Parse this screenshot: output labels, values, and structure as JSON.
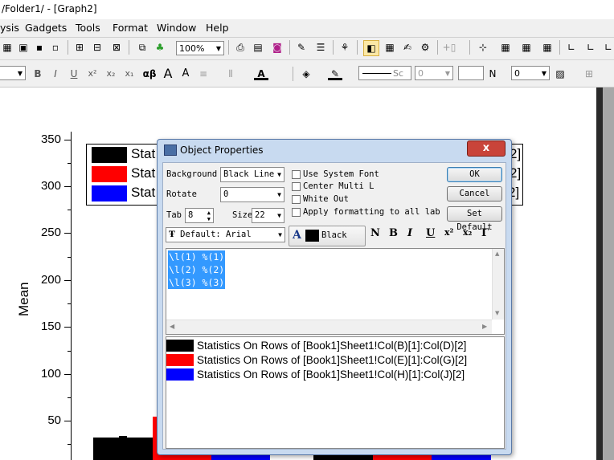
{
  "window": {
    "title": "/Folder1/ - [Graph2]"
  },
  "menu": [
    "ysis",
    "Gadgets",
    "Tools",
    "Format",
    "Window",
    "Help"
  ],
  "toolbar": {
    "zoom": "100%",
    "line_field": "Sc",
    "num_field": "0",
    "n_label": "N",
    "n_field": "0",
    "style_buttons": [
      "B",
      "I",
      "U",
      "x²",
      "x₂",
      "x₁",
      "αβ",
      "A",
      "A"
    ]
  },
  "graph": {
    "ylabel": "Mean",
    "yticks": [
      "350",
      "300",
      "250",
      "200",
      "150",
      "100",
      "50"
    ],
    "legend_visible": [
      "Stat",
      "Stat",
      "Stat"
    ],
    "legend_right": [
      "2]",
      "2]",
      "2]"
    ],
    "colors": {
      "black": "#000000",
      "red": "#ff0000",
      "blue": "#0000ff"
    }
  },
  "dialog": {
    "title": "Object Properties",
    "close": "x",
    "background_label": "Background",
    "background_value": "Black Line",
    "rotate_label": "Rotate",
    "rotate_value": "0",
    "tab_label": "Tab",
    "tab_value": "8",
    "size_label": "Size",
    "size_value": "22",
    "checkboxes": [
      "Use System Font",
      "Center Multi L",
      "White Out",
      "Apply formatting to all label"
    ],
    "ok": "OK",
    "cancel": "Cancel",
    "set_default": "Set Default",
    "font_value": "Default: Arial",
    "color_label": "Black",
    "format_buttons": [
      "N",
      "B",
      "I",
      "U",
      "x²",
      "x₂",
      "Γ"
    ],
    "text_lines": [
      "\\l(1) %(1)",
      "\\l(2) %(2)",
      "\\l(3) %(3)"
    ],
    "preview": [
      {
        "text": "Statistics On Rows of [Book1]Sheet1!Col(B)[1]:Col(D)[2]",
        "color": "#000000"
      },
      {
        "text": "Statistics On Rows of [Book1]Sheet1!Col(E)[1]:Col(G)[2]",
        "color": "#ff0000"
      },
      {
        "text": "Statistics On Rows of [Book1]Sheet1!Col(H)[1]:Col(J)[2]",
        "color": "#0000ff"
      }
    ]
  }
}
